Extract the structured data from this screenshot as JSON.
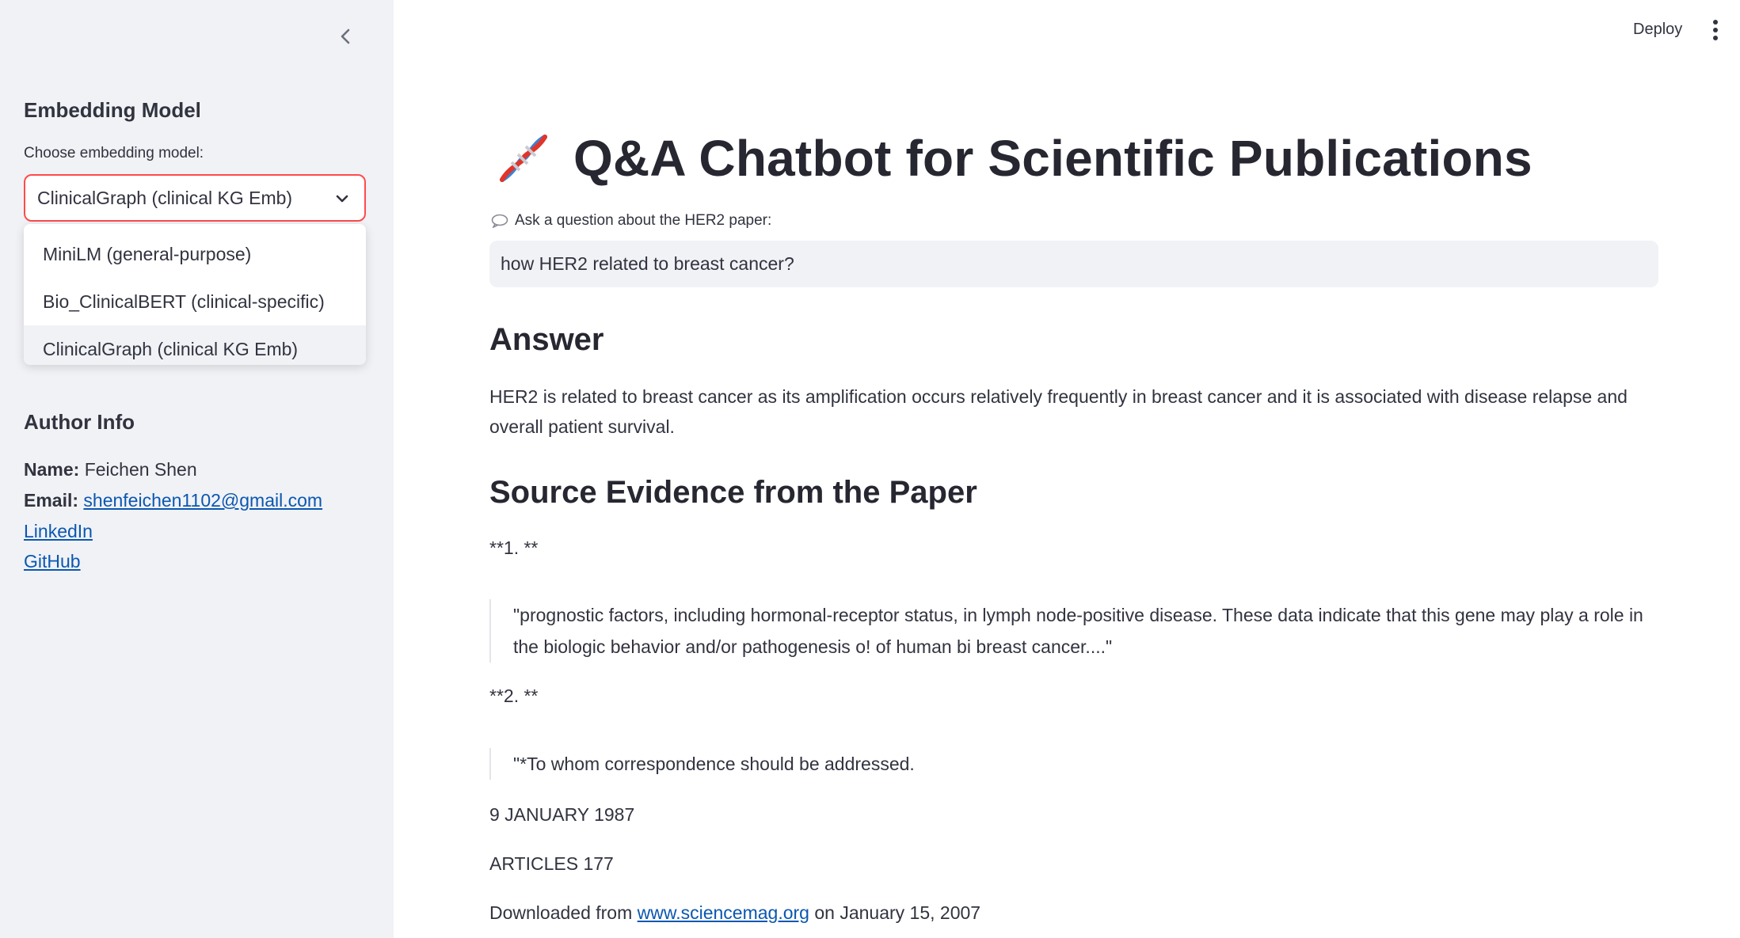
{
  "sidebar": {
    "embedding_heading": "Embedding Model",
    "select_label": "Choose embedding model:",
    "selected_model": "ClinicalGraph (clinical KG Emb)",
    "options": [
      "MiniLM (general-purpose)",
      "Bio_ClinicalBERT (clinical-specific)",
      "ClinicalGraph (clinical KG Emb)"
    ],
    "author_heading": "Author Info",
    "name_label": "Name:",
    "name_value": "Feichen Shen",
    "email_label": "Email:",
    "email_value": "shenfeichen1102@gmail.com",
    "linkedin": "LinkedIn",
    "github": "GitHub"
  },
  "header": {
    "deploy": "Deploy"
  },
  "main": {
    "title": "Q&A Chatbot for Scientific Publications",
    "question_label": "Ask a question about the HER2 paper:",
    "question_value": "how HER2 related to breast cancer?",
    "answer_heading": "Answer",
    "answer_text": "HER2 is related to breast cancer as its amplification occurs relatively frequently in breast cancer and it is associated with disease relapse and overall patient survival.",
    "evidence_heading": "Source Evidence from the Paper",
    "evidence": [
      {
        "marker": "**1. **",
        "quote": "\"prognostic factors, including hormonal-receptor status, in lymph node-positive disease. These data indicate that this gene may play a role in the biologic behavior and/or pathogenesis o! of human bi breast cancer....\""
      },
      {
        "marker": "**2. **",
        "quote": "\"*To whom correspondence should be addressed."
      }
    ],
    "date_line": "9 JANUARY 1987",
    "articles_line": "ARTICLES 177",
    "downloaded_prefix": "Downloaded from",
    "downloaded_link": "www.sciencemag.org",
    "downloaded_suffix": "on January 15, 2007"
  },
  "colors": {
    "sidebar_bg": "#f0f2f6",
    "accent": "#ff4b4b",
    "link": "#0b57b0",
    "text": "#31333f"
  },
  "icons": {
    "collapse": "chevron-left-icon",
    "dropdown": "chevron-down-icon",
    "title": "dna-icon",
    "label": "speech-bubble-icon",
    "menu": "kebab-menu-icon"
  }
}
